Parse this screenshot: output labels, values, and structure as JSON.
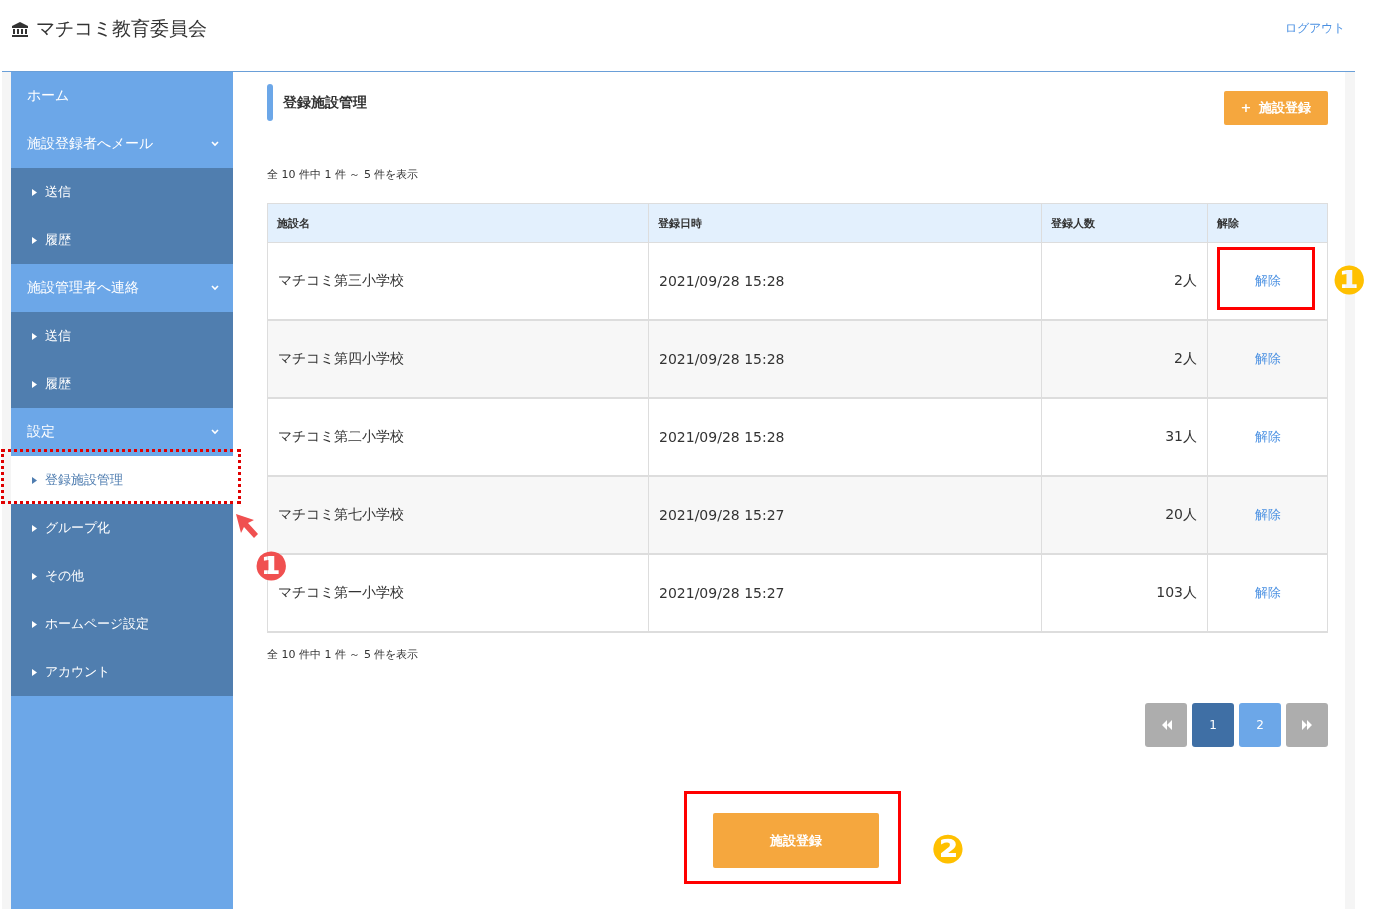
{
  "header": {
    "title": "マチコミ教育委員会",
    "logout": "ログアウト"
  },
  "sidebar": {
    "items": [
      {
        "kind": "link",
        "label": "ホーム"
      },
      {
        "kind": "group",
        "label": "施設登録者へメール",
        "expanded": true,
        "children": [
          {
            "label": "送信",
            "selected": false
          },
          {
            "label": "履歴",
            "selected": false
          }
        ]
      },
      {
        "kind": "group",
        "label": "施設管理者へ連絡",
        "expanded": true,
        "children": [
          {
            "label": "送信",
            "selected": false
          },
          {
            "label": "履歴",
            "selected": false
          }
        ]
      },
      {
        "kind": "group",
        "label": "設定",
        "expanded": true,
        "children": [
          {
            "label": "登録施設管理",
            "selected": true
          },
          {
            "label": "グループ化",
            "selected": false
          },
          {
            "label": "その他",
            "selected": false
          },
          {
            "label": "ホームページ設定",
            "selected": false
          },
          {
            "label": "アカウント",
            "selected": false
          }
        ]
      }
    ]
  },
  "page_title": "登録施設管理",
  "add_button": {
    "icon": "+",
    "label": "施設登録"
  },
  "summary_top": "全 10 件中 1 件 ～ 5 件を表示",
  "table": {
    "columns": [
      "施設名",
      "登録日時",
      "登録人数",
      "解除"
    ],
    "rows": [
      {
        "name": "マチコミ第三小学校",
        "date": "2021/09/28 15:28",
        "count": "2人",
        "action": "解除"
      },
      {
        "name": "マチコミ第四小学校",
        "date": "2021/09/28 15:28",
        "count": "2人",
        "action": "解除"
      },
      {
        "name": "マチコミ第二小学校",
        "date": "2021/09/28 15:28",
        "count": "31人",
        "action": "解除"
      },
      {
        "name": "マチコミ第七小学校",
        "date": "2021/09/28 15:27",
        "count": "20人",
        "action": "解除"
      },
      {
        "name": "マチコミ第一小学校",
        "date": "2021/09/28 15:27",
        "count": "103人",
        "action": "解除"
      }
    ]
  },
  "summary_bottom": "全 10 件中 1 件 ～ 5 件を表示",
  "pagination": [
    {
      "kind": "first"
    },
    {
      "kind": "page",
      "label": "1",
      "selected": true
    },
    {
      "kind": "page",
      "label": "2",
      "selected": false
    },
    {
      "kind": "last"
    }
  ],
  "bottom_button": "施設登録",
  "annotations": [
    {
      "kind": "dotted_box",
      "color": "#e00000"
    },
    {
      "kind": "arrow",
      "color": "#f05050"
    },
    {
      "kind": "badge",
      "label": "❶",
      "color": "#f05050"
    },
    {
      "kind": "box",
      "color": "#ff0000"
    },
    {
      "kind": "badge",
      "label": "❶",
      "color": "#ffc000"
    },
    {
      "kind": "box",
      "color": "#ff0000"
    },
    {
      "kind": "badge",
      "label": "❷",
      "color": "#ffc000"
    }
  ]
}
